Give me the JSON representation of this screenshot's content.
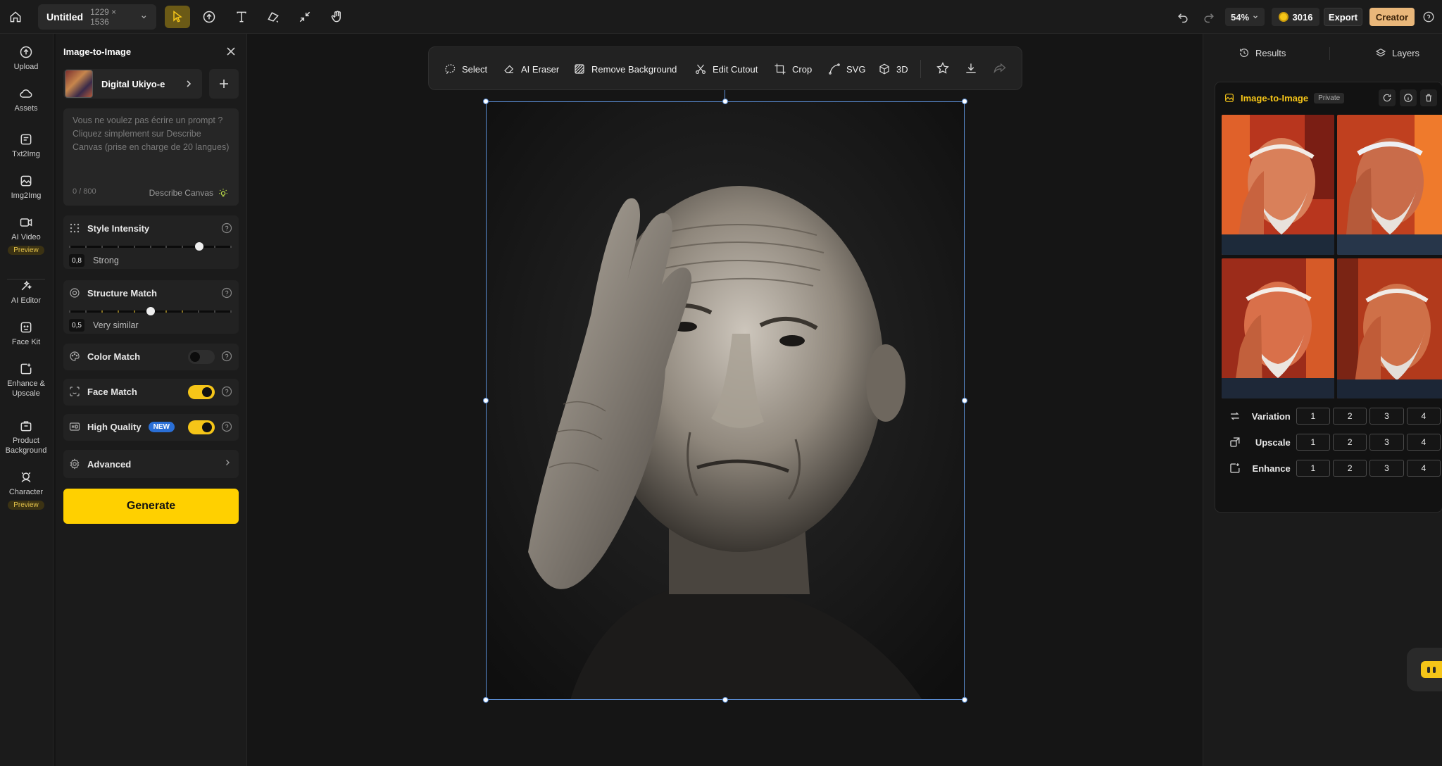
{
  "topbar": {
    "doc_name": "Untitled",
    "doc_size": "1229 × 1536",
    "zoom": "54%",
    "credits": "3016",
    "export_label": "Export",
    "plan_label": "Creator"
  },
  "rail": {
    "items": [
      {
        "label": "Upload",
        "icon": "upload-icon"
      },
      {
        "label": "Assets",
        "icon": "cloud-icon"
      },
      {
        "label": "Txt2Img",
        "icon": "text-image-icon"
      },
      {
        "label": "Img2Img",
        "icon": "image-image-icon"
      },
      {
        "label": "AI Video",
        "icon": "video-icon",
        "badge": "Preview"
      },
      {
        "label": "AI Editor",
        "icon": "sparkle-edit-icon"
      },
      {
        "label": "Face Kit",
        "icon": "face-icon"
      },
      {
        "label": "Enhance &\nUpscale",
        "icon": "enhance-icon"
      },
      {
        "label": "Product\nBackground",
        "icon": "product-icon"
      },
      {
        "label": "Character",
        "icon": "character-icon",
        "badge": "Preview"
      }
    ]
  },
  "panel": {
    "title": "Image-to-Image",
    "style_name": "Digital Ukiyo-e",
    "prompt_placeholder": "Vous ne voulez pas écrire un prompt ? Cliquez simplement sur Describe Canvas (prise en charge de 20 langues)",
    "prompt_count": "0 / 800",
    "describe_label": "Describe Canvas",
    "style_intensity": {
      "title": "Style Intensity",
      "value": "0,8",
      "label": "Strong",
      "level": 0.8
    },
    "structure_match": {
      "title": "Structure Match",
      "value": "0,5",
      "label": "Very similar",
      "level": 0.5
    },
    "color_match": {
      "title": "Color Match",
      "on": false
    },
    "face_match": {
      "title": "Face Match",
      "on": true
    },
    "high_quality": {
      "title": "High Quality",
      "badge": "NEW",
      "on": true
    },
    "advanced": {
      "title": "Advanced"
    },
    "generate_label": "Generate"
  },
  "floatbar": {
    "select": "Select",
    "ai_eraser": "AI Eraser",
    "remove_bg": "Remove Background",
    "edit_cutout": "Edit Cutout",
    "crop": "Crop",
    "svg": "SVG",
    "three_d": "3D"
  },
  "right": {
    "tab_results": "Results",
    "tab_layers": "Layers",
    "card_title": "Image-to-Image",
    "card_badge": "Private",
    "rows": [
      {
        "label": "Variation",
        "icon": "variation-icon",
        "nums": [
          "1",
          "2",
          "3",
          "4"
        ]
      },
      {
        "label": "Upscale",
        "icon": "upscale-icon",
        "nums": [
          "1",
          "2",
          "3",
          "4"
        ]
      },
      {
        "label": "Enhance",
        "icon": "enhance-icon",
        "nums": [
          "1",
          "2",
          "3",
          "4"
        ]
      }
    ]
  },
  "colors": {
    "accent": "#ffd000",
    "selection": "#5b8fd6",
    "new_badge": "#2a6fd6"
  }
}
